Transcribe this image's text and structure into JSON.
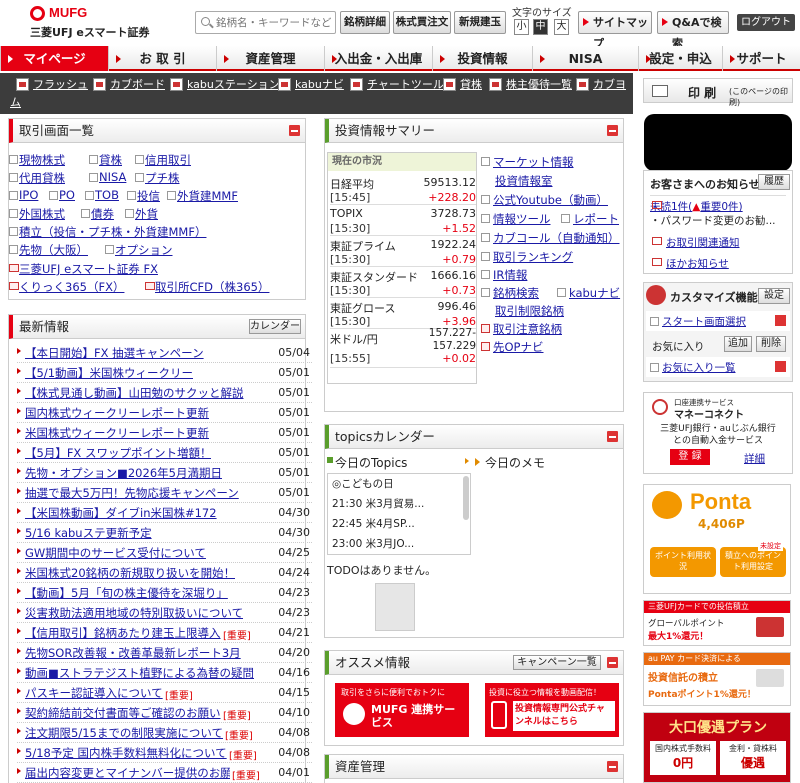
{
  "header": {
    "logo": "MUFG",
    "logo_sub": "三菱UFJ eスマート証券",
    "search_placeholder": "銘柄名・キーワードなど",
    "btn_meigara": "銘柄詳細",
    "btn_kabuka": "株式買注文",
    "btn_shinyo": "新規建玉",
    "fontsize_label": "文字のサイズ",
    "fs_small": "小",
    "fs_mid": "中",
    "fs_large": "大",
    "sitemap": "サイトマップ",
    "qa": "Q&Aで検索",
    "logout": "ログアウト"
  },
  "nav": [
    {
      "label": "マイページ"
    },
    {
      "label": "お 取 引"
    },
    {
      "label": "資産管理"
    },
    {
      "label": "入出金・入出庫"
    },
    {
      "label": "投資情報"
    },
    {
      "label": "NISA"
    },
    {
      "label": "設定・申込"
    },
    {
      "label": "サポート"
    }
  ],
  "toolbar": {
    "items": [
      "フラッシュ",
      "カブボード",
      "kabuステーション",
      "kabuナビ",
      "チャートツール",
      "貸株",
      "株主優待一覧",
      "カブヨ"
    ],
    "overflow": "ム"
  },
  "print": {
    "label": "印 刷",
    "sub": "(このページの印刷)"
  },
  "torihiki": {
    "title": "取引画面一覧",
    "rows": [
      [
        "現物株式",
        "貸株",
        "信用取引"
      ],
      [
        "代用貸株",
        "NISA",
        "プチ株"
      ],
      [
        "IPO",
        "PO",
        "TOB",
        "投信",
        "外貨建MMF"
      ],
      [
        "外国株式",
        "債券",
        "外貨"
      ],
      [
        "積立（投信・プチ株・外貨建MMF）"
      ],
      [
        "先物（大阪）",
        "オプション"
      ],
      [
        "三菱UFJ eスマート証券 FX"
      ],
      [
        "くりっく365（FX）",
        "取引所CFD（株365）"
      ]
    ]
  },
  "news": {
    "title": "最新情報",
    "calendar_btn": "カレンダー",
    "items": [
      {
        "t": "【本日開始】FX 抽選キャンペーン",
        "d": "05/04"
      },
      {
        "t": "【5/1動画】米国株ウィークリー",
        "d": "05/01"
      },
      {
        "t": "【株式見通し動画】山田勉のサクッと解説",
        "d": "05/01"
      },
      {
        "t": "国内株式ウィークリーレポート更新",
        "d": "05/01"
      },
      {
        "t": "米国株式ウィークリーレポート更新",
        "d": "05/01"
      },
      {
        "t": "【5月】FX スワップポイント増額！",
        "d": "05/01"
      },
      {
        "t": "先物・オプション■2026年5月満期日",
        "d": "05/01"
      },
      {
        "t": "抽選で最大5万円！先物応援キャンペーン",
        "d": "05/01"
      },
      {
        "t": "【米国株動画】ダイブin米国株#172",
        "d": "04/30"
      },
      {
        "t": "5/16 kabuステ更新予定",
        "d": "04/30"
      },
      {
        "t": "GW期間中のサービス受付について",
        "d": "04/25"
      },
      {
        "t": "米国株式20銘柄の新規取り扱いを開始！",
        "d": "04/24"
      },
      {
        "t": "【動画】5月「旬の株主優待を深堀り」",
        "d": "04/23"
      },
      {
        "t": "災害救助法適用地域の特別取扱いについて",
        "d": "04/23"
      },
      {
        "t": "【信用取引】銘柄あたり建玉上限導入",
        "d": "04/21",
        "tag": "[重要]"
      },
      {
        "t": "先物SOR改善報・改善革最新レポート3月",
        "d": "04/20"
      },
      {
        "t": "動画■ストラテジスト植野による為替の疑問",
        "d": "04/16"
      },
      {
        "t": "パスキー認証導入について",
        "d": "04/15",
        "tag": "[重要]"
      },
      {
        "t": "契約締結前交付書面等ご確認のお願い",
        "d": "04/10",
        "tag": "[重要]"
      },
      {
        "t": "注文期限5/15までの制限実施について",
        "d": "04/08",
        "tag": "[重要]"
      },
      {
        "t": "5/18予定 国内株手数料無料化について",
        "d": "04/08",
        "tag": "[重要]"
      },
      {
        "t": "届出内容変更とマイナンバー提供のお願い",
        "d": "04/01",
        "tag": "[重要]"
      }
    ]
  },
  "summary": {
    "title": "投資情報サマリー",
    "market_label": "現在の市況",
    "market": [
      {
        "n": "日経平均",
        "v": "59513.12",
        "t": "[15:45]",
        "c": "+228.20"
      },
      {
        "n": "TOPIX",
        "v": "3728.73",
        "t": "[15:30]",
        "c": "+1.52"
      },
      {
        "n": "東証プライム",
        "v": "1922.24",
        "t": "[15:30]",
        "c": "+0.79"
      },
      {
        "n": "東証スタンダード",
        "v": "1666.16",
        "t": "[15:30]",
        "c": "+0.73"
      },
      {
        "n": "東証グロース",
        "v": "996.46",
        "t": "[15:30]",
        "c": "+3.96"
      },
      {
        "n": "米ドル/円",
        "v": "157.227-",
        "v2": "157.229",
        "t": "[15:55]",
        "c": "+0.02"
      }
    ],
    "links": [
      "マーケット情報",
      "投資情報室",
      "公式Youtube（動画）",
      "情報ツール",
      "レポート",
      "カブコール（自動通知）",
      "取引ランキング",
      "IR情報",
      "銘柄検索",
      "kabuナビ",
      "取引制限銘柄",
      "取引注意銘柄",
      "先OPナビ"
    ]
  },
  "topics": {
    "title": "topicsカレンダー",
    "today_topics": "今日のTopics",
    "today_memo": "今日のメモ",
    "items": [
      "◎こどもの日",
      "21:30 米3月貿易...",
      "22:45 米4月SP...",
      "23:00 米3月JO..."
    ],
    "todo": "TODOはありません。"
  },
  "osusume": {
    "title": "オススメ情報",
    "campaign_btn": "キャンペーン一覧",
    "banner1_top": "取引をさらに便利でおトクに",
    "banner1_main": "MUFG 連携サービス",
    "banner2_top": "投資に役立つ情報を動画配信！",
    "banner2_main": "投資情報専門公式チャンネルはこちら"
  },
  "shisan": {
    "title": "資産管理"
  },
  "notice": {
    "title": "お客さまへのお知らせ",
    "history_btn": "履歴",
    "unread": "未読1件(",
    "important": "重要0件)",
    "pwd": "・パスワード変更のお勧...",
    "kanren": "お取引関連通知",
    "hoka": "ほかお知らせ"
  },
  "customize": {
    "title": "カスタマイズ機能",
    "setting_btn": "設定",
    "start": "スタート画面選択",
    "fav": "お気に入り",
    "add": "追加",
    "del": "削除",
    "favlist": "お気に入り一覧"
  },
  "money": {
    "sub": "口座連携サービス",
    "name": "マネーコネクト",
    "desc1": "三菱UFJ銀行・auじぶん銀行",
    "desc2": "との自動入金サービス",
    "register": "登 録",
    "detail": "詳細"
  },
  "ponta": {
    "name": "Ponta",
    "points": "4,406P",
    "btn1": "ポイント利用状況",
    "btn2": "積立へのポイント利用設定",
    "badge": "未設定"
  },
  "banner_a": {
    "l1": "三菱UFJカードでの投信積立",
    "l2": "グローバルポイント",
    "l3": "最大1%還元！"
  },
  "banner_b": {
    "l1": "au PAY カード決済による",
    "l2": "投資信託の積立",
    "l3": "Pontaポイント1%還元！"
  },
  "banner_c": {
    "l1": "大口優遇プラン",
    "l2": "国内株式手数料",
    "l3": "0円",
    "l4": "金利・貸株料",
    "l5": "優遇"
  },
  "colors": {
    "accent": "#e60012",
    "nav_bg": "#3c3c3c",
    "link": "#1a1aa6",
    "ponta": "#f39800"
  }
}
